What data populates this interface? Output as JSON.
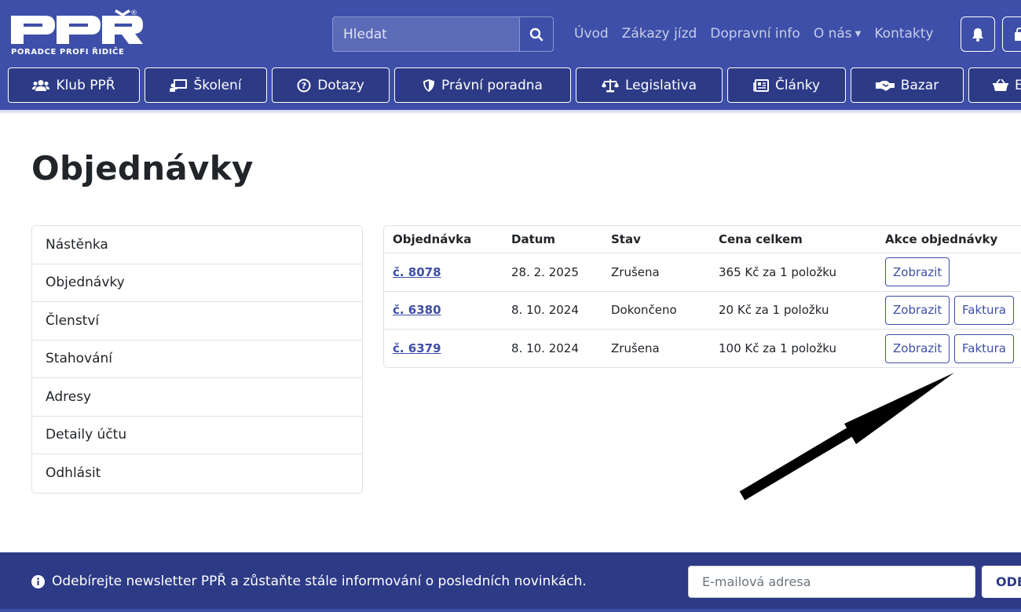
{
  "brand": {
    "tagline": "PORADCE PROFI ŘIDIČE",
    "reg_mark": "®"
  },
  "search": {
    "placeholder": "Hledat"
  },
  "top_nav": [
    {
      "label": "Úvod"
    },
    {
      "label": "Zákazy jízd"
    },
    {
      "label": "Dopravní info"
    },
    {
      "label": "O nás"
    },
    {
      "label": "Kontakty"
    }
  ],
  "main_nav": [
    {
      "label": "Klub PPŘ",
      "icon": "users-icon"
    },
    {
      "label": "Školení",
      "icon": "presentation-icon"
    },
    {
      "label": "Dotazy",
      "icon": "question-circle-icon"
    },
    {
      "label": "Právní poradna",
      "icon": "shield-icon"
    },
    {
      "label": "Legislativa",
      "icon": "scales-icon"
    },
    {
      "label": "Články",
      "icon": "newspaper-icon"
    },
    {
      "label": "Bazar",
      "icon": "handshake-icon"
    },
    {
      "label": "E",
      "icon": "basket-icon"
    }
  ],
  "page": {
    "title": "Objednávky"
  },
  "sidebar": [
    {
      "label": "Nástěnka"
    },
    {
      "label": "Objednávky"
    },
    {
      "label": "Členství"
    },
    {
      "label": "Stahování"
    },
    {
      "label": "Adresy"
    },
    {
      "label": "Detaily účtu"
    },
    {
      "label": "Odhlásit"
    }
  ],
  "orders": {
    "headers": [
      "Objednávka",
      "Datum",
      "Stav",
      "Cena celkem",
      "Akce objednávky"
    ],
    "rows": [
      {
        "number": "č. 8078",
        "date": "28. 2. 2025",
        "status": "Zrušena",
        "total": "365 Kč za 1 položku",
        "view": "Zobrazit"
      },
      {
        "number": "č. 6380",
        "date": "8. 10. 2024",
        "status": "Dokončeno",
        "total": "20 Kč za 1 položku",
        "view": "Zobrazit",
        "invoice": "Faktura"
      },
      {
        "number": "č. 6379",
        "date": "8. 10. 2024",
        "status": "Zrušena",
        "total": "100 Kč za 1 položku",
        "view": "Zobrazit",
        "invoice": "Faktura"
      }
    ]
  },
  "newsletter": {
    "text": "Odebírejte newsletter PPŘ a zůstaňte stále informování o posledních novinkách.",
    "placeholder": "E-mailová adresa",
    "button": "ODE"
  },
  "colors": {
    "header_bg": "#3d4fa8",
    "nav_button_bg": "#2d3a86",
    "link": "#3d4fa8"
  }
}
